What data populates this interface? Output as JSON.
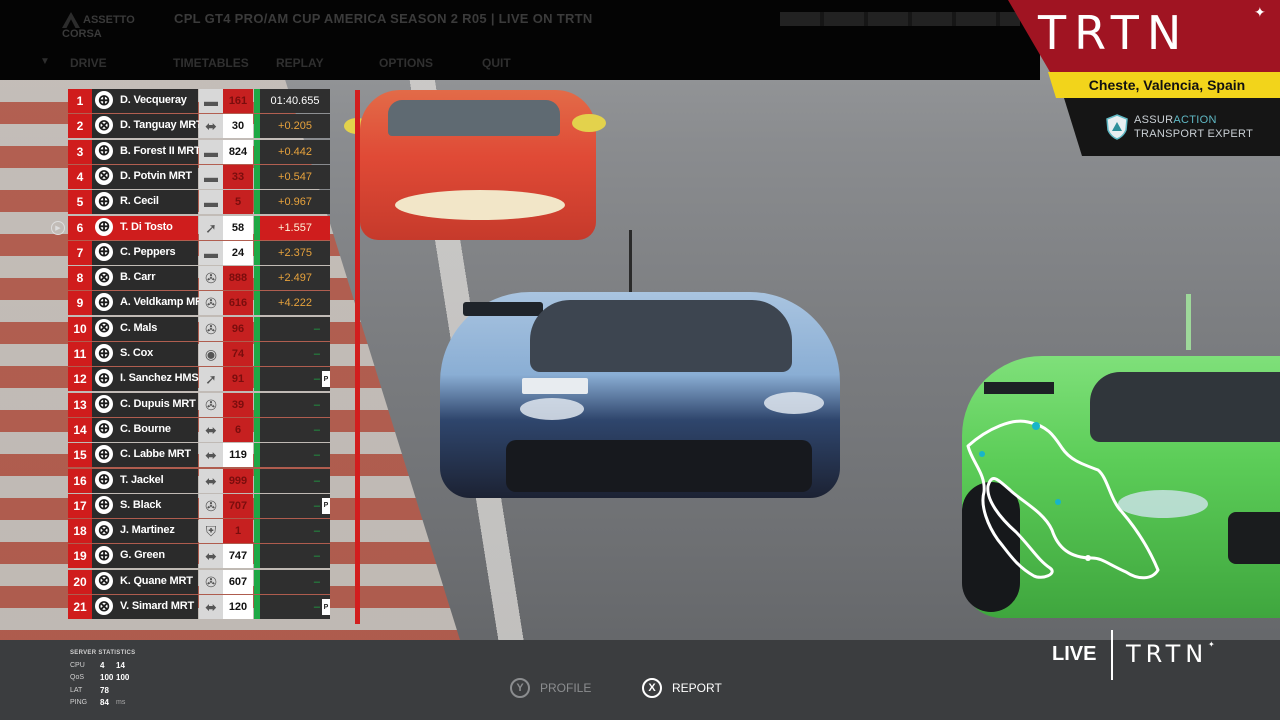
{
  "window": {
    "app_logo_text": "ASSETTO CORSA",
    "broadcast_title": "CPL GT4 PRO/AM CUP AMERICA SEASON 2 R05 | LIVE ON TRTN",
    "nav": [
      "DRIVE",
      "TIMETABLES",
      "REPLAY",
      "OPTIONS",
      "QUIT"
    ]
  },
  "brand": {
    "logo": "TRTN",
    "location": "Cheste, Valencia, Spain",
    "sponsor_line1_a": "ASSUR",
    "sponsor_line1_b": "ACTION",
    "sponsor_line2": "TRANSPORT EXPERT"
  },
  "standings": [
    {
      "pos": "1",
      "platform": "pc",
      "name": "D. Vecqueray",
      "brand": "aston",
      "num": "161",
      "num_style": "red",
      "gap": "01:40.655"
    },
    {
      "pos": "2",
      "platform": "xbox",
      "name": "D. Tanguay  MRT",
      "brand": "chevrolet",
      "num": "30",
      "num_style": "white",
      "gap": "+0.205"
    },
    {
      "pos": "3",
      "platform": "pc",
      "name": "B. Forest II MRT",
      "brand": "aston",
      "num": "824",
      "num_style": "white",
      "gap": "+0.442"
    },
    {
      "pos": "4",
      "platform": "xbox",
      "name": "D. Potvin  MRT",
      "brand": "aston",
      "num": "33",
      "num_style": "red",
      "gap": "+0.547"
    },
    {
      "pos": "5",
      "platform": "pc",
      "name": "R. Cecil",
      "brand": "aston",
      "num": "5",
      "num_style": "red",
      "gap": "+0.967"
    },
    {
      "pos": "6",
      "platform": "pc",
      "name": "T. Di Tosto",
      "brand": "mclaren",
      "num": "58",
      "num_style": "white",
      "gap": "+1.557",
      "highlight": true
    },
    {
      "pos": "7",
      "platform": "pc",
      "name": "C. Peppers",
      "brand": "aston",
      "num": "24",
      "num_style": "white",
      "gap": "+2.375"
    },
    {
      "pos": "8",
      "platform": "xbox",
      "name": "B. Carr",
      "brand": "mercedes",
      "num": "888",
      "num_style": "red",
      "gap": "+2.497"
    },
    {
      "pos": "9",
      "platform": "pc",
      "name": "A. Veldkamp MRT",
      "brand": "mercedes",
      "num": "616",
      "num_style": "red",
      "gap": "+4.222"
    },
    {
      "pos": "10",
      "platform": "xbox",
      "name": "C. Mals",
      "brand": "mercedes",
      "num": "96",
      "num_style": "red",
      "gap": "–"
    },
    {
      "pos": "11",
      "platform": "pc",
      "name": "S. Cox",
      "brand": "bmw",
      "num": "74",
      "num_style": "red",
      "gap": "–"
    },
    {
      "pos": "12",
      "platform": "pc",
      "name": "I. Sanchez HMS",
      "brand": "mclaren",
      "num": "91",
      "num_style": "red",
      "gap": "–",
      "pit": "P"
    },
    {
      "pos": "13",
      "platform": "pc",
      "name": "C. Dupuis  MRT",
      "brand": "mercedes",
      "num": "39",
      "num_style": "red",
      "gap": "–"
    },
    {
      "pos": "14",
      "platform": "pc",
      "name": "C. Bourne",
      "brand": "chevrolet",
      "num": "6",
      "num_style": "red",
      "gap": "–"
    },
    {
      "pos": "15",
      "platform": "pc",
      "name": "C. Labbe  MRT",
      "brand": "chevrolet",
      "num": "119",
      "num_style": "white",
      "gap": "–"
    },
    {
      "pos": "16",
      "platform": "pc",
      "name": "T. Jackel",
      "brand": "chevrolet",
      "num": "999",
      "num_style": "red",
      "gap": "–"
    },
    {
      "pos": "17",
      "platform": "pc",
      "name": "S. Black",
      "brand": "mercedes",
      "num": "707",
      "num_style": "red",
      "gap": "–",
      "pit": "P"
    },
    {
      "pos": "18",
      "platform": "xbox",
      "name": "J. Martinez",
      "brand": "porsche",
      "num": "1",
      "num_style": "red",
      "gap": "–"
    },
    {
      "pos": "19",
      "platform": "pc",
      "name": "G. Green",
      "brand": "chevrolet",
      "num": "747",
      "num_style": "white",
      "gap": "–"
    },
    {
      "pos": "20",
      "platform": "xbox",
      "name": "K. Quane MRT",
      "brand": "mercedes",
      "num": "607",
      "num_style": "white",
      "gap": "–"
    },
    {
      "pos": "21",
      "platform": "xbox",
      "name": "V. Simard  MRT",
      "brand": "chevrolet",
      "num": "120",
      "num_style": "white",
      "gap": "–",
      "pit": "P"
    }
  ],
  "server_stats": {
    "heading": "SERVER STATISTICS",
    "rows": [
      {
        "label": "CPU",
        "v1": "4",
        "v2": "14"
      },
      {
        "label": "QoS",
        "v1": "100",
        "v2": "100"
      },
      {
        "label": "LAT",
        "v1": "78",
        "v2": ""
      },
      {
        "label": "PING",
        "v1": "84",
        "v2": "ms"
      }
    ]
  },
  "buttons": {
    "profile_key": "Y",
    "profile_label": "PROFILE",
    "report_key": "X",
    "report_label": "REPORT"
  },
  "live": {
    "label": "LIVE",
    "logo": "TRTN"
  },
  "colors": {
    "position_red": "#d01c1c",
    "gap_orange": "#e7a23c",
    "gap_green": "#1ea845",
    "brand_red": "#a01422",
    "brand_yellow": "#f2d41b"
  },
  "icons": {
    "pc": "globe-icon",
    "xbox": "xbox-icon",
    "aston": "aston-martin-wings-icon",
    "chevrolet": "chevrolet-bowtie-icon",
    "mercedes": "mercedes-star-icon",
    "bmw": "bmw-roundel-icon",
    "mclaren": "mclaren-swoosh-icon",
    "porsche": "porsche-crest-icon"
  }
}
